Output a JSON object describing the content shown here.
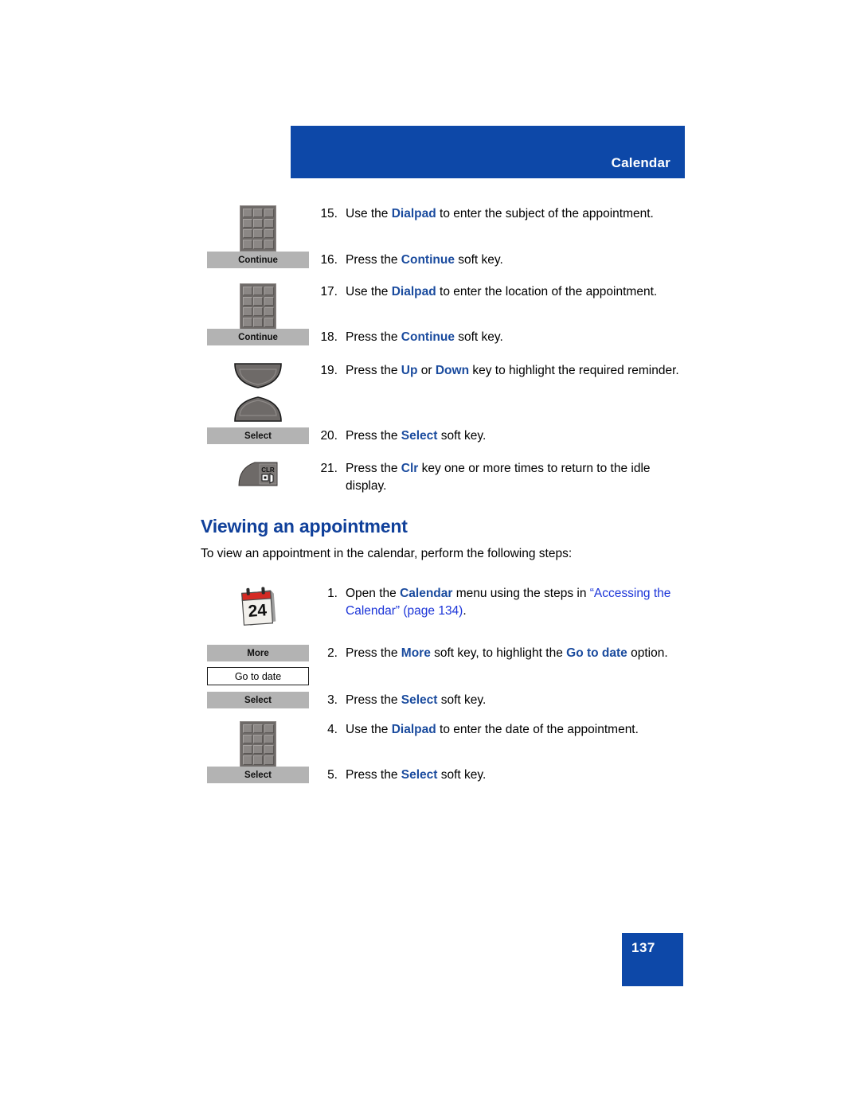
{
  "header": {
    "title": "Calendar"
  },
  "section": {
    "heading": "Viewing an appointment",
    "intro": "To view an appointment in the calendar, perform the following steps:"
  },
  "softkeys": {
    "continue": "Continue",
    "select": "Select",
    "more": "More",
    "go_to_date": "Go to date"
  },
  "icons": {
    "dialpad": "dialpad-icon",
    "nav_up": "navigation-up-key-icon",
    "nav_down": "navigation-down-key-icon",
    "clr": "clr-key-icon",
    "clr_label": "CLR",
    "calendar": "calendar-icon",
    "calendar_day": "24"
  },
  "colors": {
    "brand_blue": "#0d48a8",
    "heading_blue": "#10409a",
    "emphasis_blue": "#1a4b9e",
    "xref_blue": "#1b34d8",
    "softkey_gray": "#b3b3b3",
    "icon_gray": "#6e6a68"
  },
  "steps_continued": [
    {
      "num": "15.",
      "parts": [
        {
          "t": "Use the ",
          "s": "plain"
        },
        {
          "t": "Dialpad",
          "s": "em"
        },
        {
          "t": " to enter the subject of the appointment.",
          "s": "plain"
        }
      ]
    },
    {
      "num": "16.",
      "parts": [
        {
          "t": "Press the ",
          "s": "plain"
        },
        {
          "t": "Continue",
          "s": "em"
        },
        {
          "t": " soft key.",
          "s": "plain"
        }
      ]
    },
    {
      "num": "17.",
      "parts": [
        {
          "t": "Use the ",
          "s": "plain"
        },
        {
          "t": "Dialpad",
          "s": "em"
        },
        {
          "t": " to enter the location of the appointment.",
          "s": "plain"
        }
      ]
    },
    {
      "num": "18.",
      "parts": [
        {
          "t": "Press the ",
          "s": "plain"
        },
        {
          "t": "Continue",
          "s": "em"
        },
        {
          "t": " soft key.",
          "s": "plain"
        }
      ]
    },
    {
      "num": "19.",
      "parts": [
        {
          "t": "Press the ",
          "s": "plain"
        },
        {
          "t": "Up",
          "s": "em"
        },
        {
          "t": " or ",
          "s": "plain"
        },
        {
          "t": "Down",
          "s": "em"
        },
        {
          "t": " key to highlight the required reminder.",
          "s": "plain"
        }
      ]
    },
    {
      "num": "20.",
      "parts": [
        {
          "t": "Press the ",
          "s": "plain"
        },
        {
          "t": "Select",
          "s": "em"
        },
        {
          "t": " soft key.",
          "s": "plain"
        }
      ]
    },
    {
      "num": "21.",
      "parts": [
        {
          "t": "Press the ",
          "s": "plain"
        },
        {
          "t": "Clr",
          "s": "em"
        },
        {
          "t": " key one or more times to return to the idle display.",
          "s": "plain"
        }
      ]
    }
  ],
  "steps_viewing": [
    {
      "num": "1.",
      "parts": [
        {
          "t": "Open the ",
          "s": "plain"
        },
        {
          "t": "Calendar",
          "s": "em"
        },
        {
          "t": " menu using the steps in ",
          "s": "plain"
        },
        {
          "t": "“Accessing the Calendar” (page 134)",
          "s": "xref"
        },
        {
          "t": ".",
          "s": "plain"
        }
      ]
    },
    {
      "num": "2.",
      "parts": [
        {
          "t": "Press the ",
          "s": "plain"
        },
        {
          "t": "More",
          "s": "em"
        },
        {
          "t": " soft key, to highlight the ",
          "s": "plain"
        },
        {
          "t": "Go to date",
          "s": "em"
        },
        {
          "t": " option.",
          "s": "plain"
        }
      ]
    },
    {
      "num": "3.",
      "parts": [
        {
          "t": "Press the ",
          "s": "plain"
        },
        {
          "t": "Select",
          "s": "em"
        },
        {
          "t": " soft key.",
          "s": "plain"
        }
      ]
    },
    {
      "num": "4.",
      "parts": [
        {
          "t": "Use the ",
          "s": "plain"
        },
        {
          "t": "Dialpad",
          "s": "em"
        },
        {
          "t": " to enter the date of the appointment.",
          "s": "plain"
        }
      ]
    },
    {
      "num": "5.",
      "parts": [
        {
          "t": "Press the ",
          "s": "plain"
        },
        {
          "t": "Select",
          "s": "em"
        },
        {
          "t": " soft key.",
          "s": "plain"
        }
      ]
    }
  ],
  "footer": {
    "page_number": "137"
  }
}
